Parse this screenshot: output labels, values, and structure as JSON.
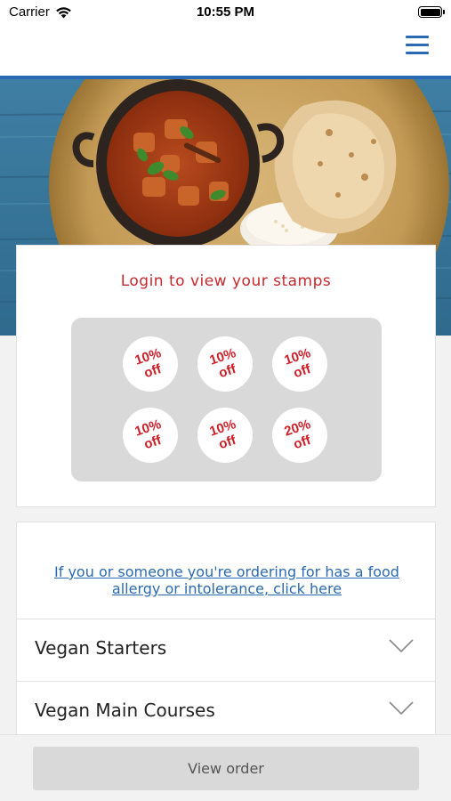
{
  "status_bar": {
    "carrier": "Carrier",
    "time": "10:55 PM",
    "icons": [
      "wifi-icon",
      "battery-icon"
    ]
  },
  "nav": {
    "menu_icon": "hamburger-menu-icon",
    "accent_color": "#2a6ab2"
  },
  "hero": {
    "image": "curry-dish-with-naan-and-rice"
  },
  "stamps": {
    "title": "Login to view your stamps",
    "title_color": "#c8282d",
    "items": [
      {
        "percent": "10%",
        "suffix": "off"
      },
      {
        "percent": "10%",
        "suffix": "off"
      },
      {
        "percent": "10%",
        "suffix": "off"
      },
      {
        "percent": "10%",
        "suffix": "off"
      },
      {
        "percent": "10%",
        "suffix": "off"
      },
      {
        "percent": "20%",
        "suffix": "off"
      }
    ]
  },
  "menu": {
    "allergy_link": "If you or someone you're ordering for has a food allergy or intolerance, click here",
    "categories": [
      {
        "label": "Vegan Starters",
        "icon": "chevron-down-icon"
      },
      {
        "label": "Vegan Main Courses",
        "icon": "chevron-down-icon"
      }
    ]
  },
  "footer": {
    "view_order_label": "View order"
  }
}
